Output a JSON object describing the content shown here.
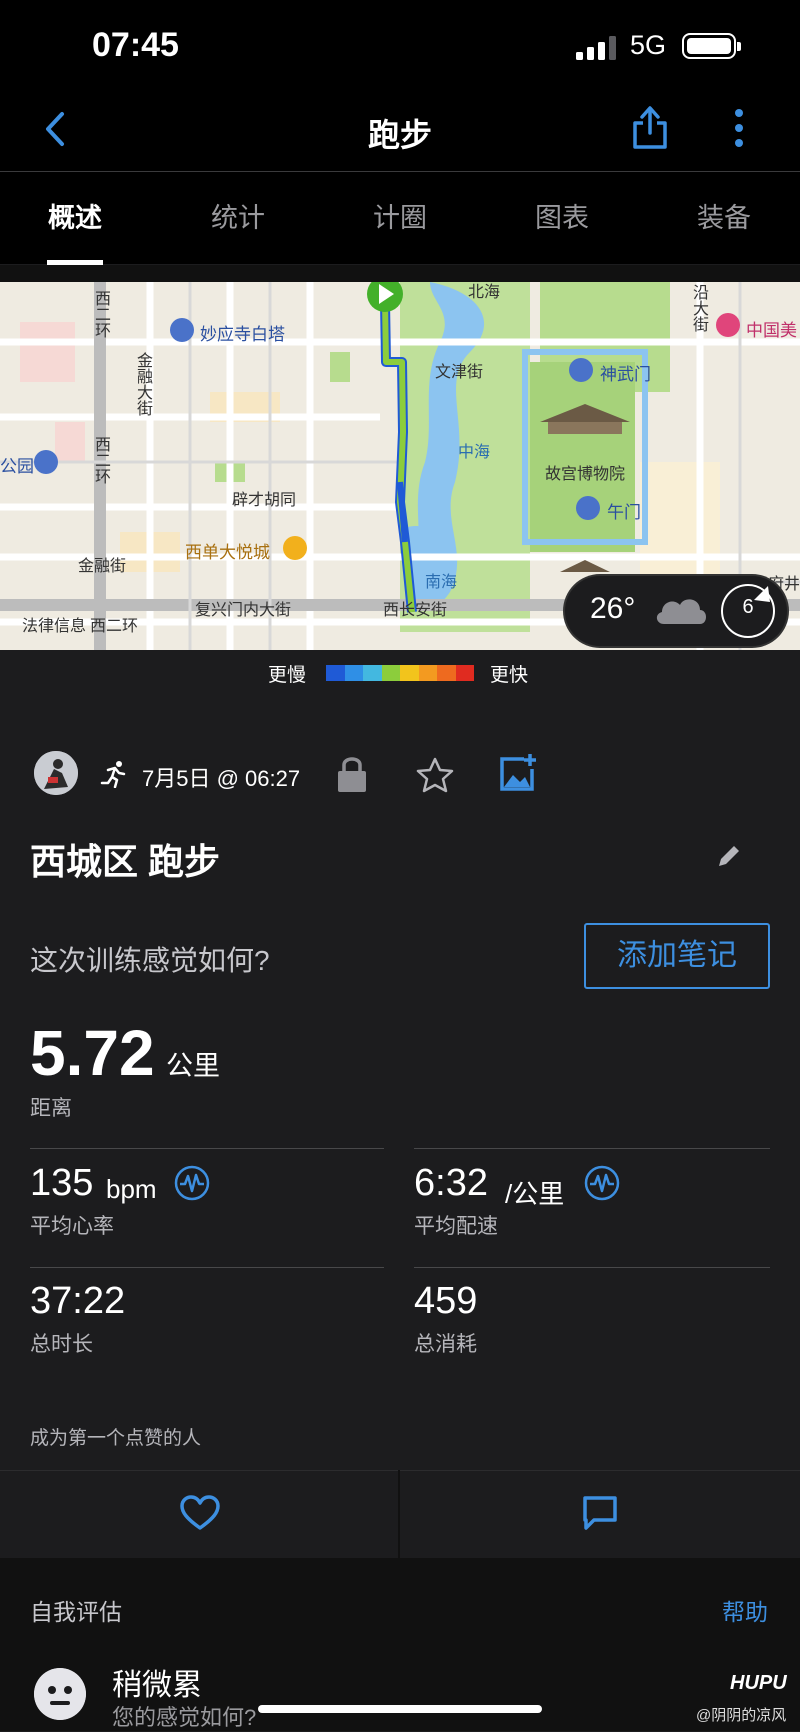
{
  "status_bar": {
    "time": "07:45",
    "network": "5G"
  },
  "nav": {
    "title": "跑步"
  },
  "tabs": [
    {
      "label": "概述",
      "active": true
    },
    {
      "label": "统计",
      "active": false
    },
    {
      "label": "计圈",
      "active": false
    },
    {
      "label": "图表",
      "active": false
    },
    {
      "label": "装备",
      "active": false
    }
  ],
  "map": {
    "labels": [
      "西二环",
      "妙应寺白塔",
      "北海",
      "文津街",
      "神武门",
      "沿大街",
      "中国美",
      "金融大街",
      "西二环",
      "中海",
      "故宫博物院",
      "公园",
      "辟才胡同",
      "午门",
      "西单大悦城",
      "金融街",
      "南海",
      "复兴门内大街",
      "西长安街",
      "法律信息",
      "西二环",
      "王府井"
    ],
    "weather": {
      "temp": "26°",
      "wind": "6"
    }
  },
  "legend": {
    "slow": "更慢",
    "fast": "更快",
    "colors": [
      "#1f5ad6",
      "#2f8fe6",
      "#43b8e0",
      "#8ccd3c",
      "#f2c41c",
      "#f39a20",
      "#ee6a1f",
      "#e02b20"
    ]
  },
  "activity": {
    "datetime": "7月5日 @ 06:27",
    "title": "西城区 跑步",
    "feel_prompt": "这次训练感觉如何?",
    "add_note": "添加笔记",
    "distance": {
      "value": "5.72",
      "unit": "公里",
      "label": "距离"
    },
    "heart_rate": {
      "value": "135",
      "unit": "bpm",
      "label": "平均心率"
    },
    "pace": {
      "value": "6:32",
      "unit": "/公里",
      "label": "平均配速"
    },
    "duration": {
      "value": "37:22",
      "label": "总时长"
    },
    "calories": {
      "value": "459",
      "label": "总消耗"
    },
    "likes_text": "成为第一个点赞的人"
  },
  "self_eval": {
    "title": "自我评估",
    "help": "帮助",
    "rating": "稍微累",
    "prompt": "您的感觉如何?"
  },
  "watermark": {
    "logo": "HUPU",
    "user": "@阴阴的凉风"
  }
}
